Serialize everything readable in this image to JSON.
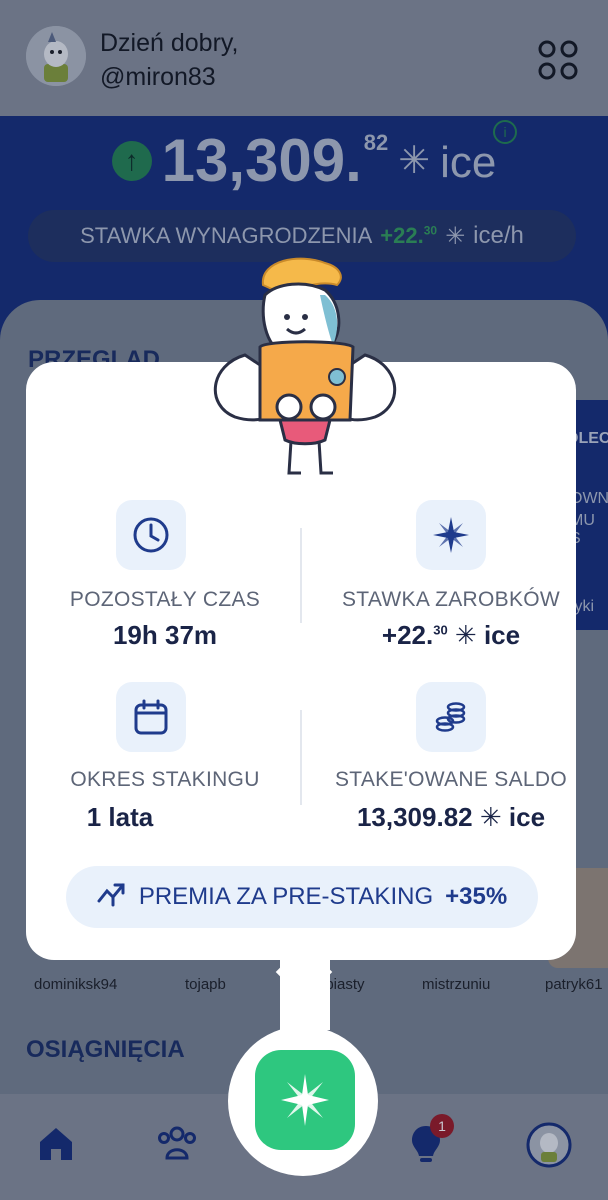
{
  "header": {
    "greeting": "Dzień dobry,",
    "username": "@miron83"
  },
  "balance": {
    "main": "13,309.",
    "decimals": "82",
    "unit": "ice",
    "star": "✳"
  },
  "rate_pill": {
    "label": "STAWKA WYNAGRODZENIA",
    "value": "+22.",
    "decimals": "30",
    "unit": "ice/h"
  },
  "sections": {
    "overview": "PRZEGLĄD",
    "achievements": "OSIĄGNIĘCIA"
  },
  "right_card_texts": [
    "OLEC",
    "OWN",
    "MU S",
    "tyki"
  ],
  "users": [
    "dominiksk94",
    "tojapb",
    "erbiasty",
    "mistrzuniu",
    "patryk61"
  ],
  "popup": {
    "stats": [
      {
        "label": "POZOSTAŁY CZAS",
        "value": "19h 37m",
        "icon": "clock-icon"
      },
      {
        "label": "STAWKA ZAROBKÓW",
        "value": "+22.",
        "decimals": "30",
        "unit": "ice",
        "icon": "ice-star-icon"
      },
      {
        "label": "OKRES STAKINGU",
        "value": "1 lata",
        "icon": "calendar-icon"
      },
      {
        "label": "STAKE'OWANE SALDO",
        "value": "13,309.82",
        "unit": "ice",
        "icon": "coins-icon"
      }
    ],
    "bonus_label": "PREMIA ZA PRE-STAKING",
    "bonus_value": "+35%"
  },
  "nav": {
    "badge_count": "1"
  },
  "colors": {
    "accent_blue": "#1f3b8c",
    "accent_green": "#2ec77f",
    "brand_navy": "#1a2447"
  }
}
